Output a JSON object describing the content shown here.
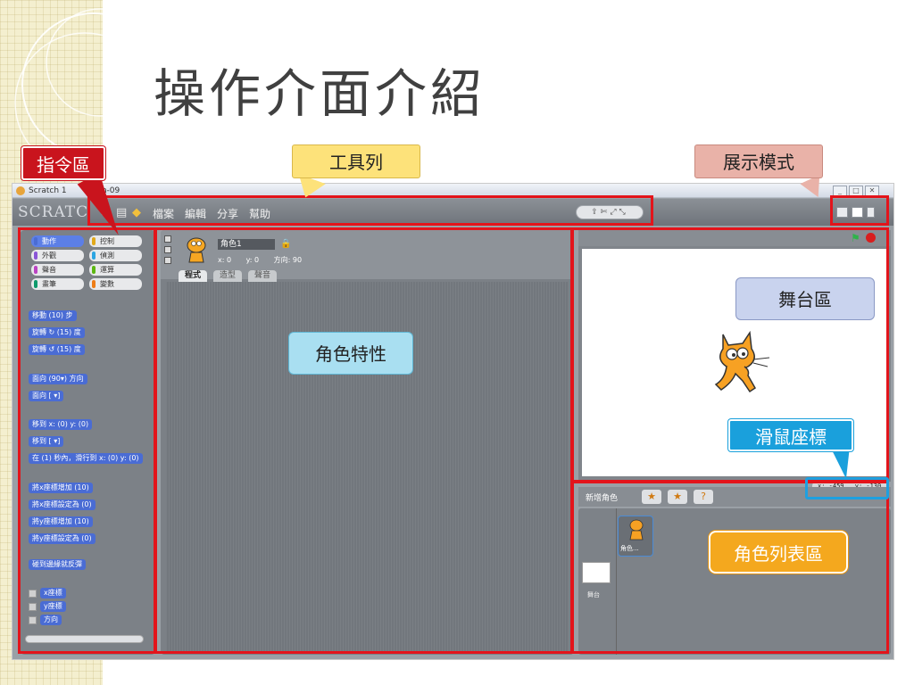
{
  "slide": {
    "title": "操作介面介紹"
  },
  "callouts": {
    "command_area": "指令區",
    "toolbar": "工具列",
    "display_mode": "展示模式",
    "stage_area": "舞台區",
    "sprite_props": "角色特性",
    "mouse_coords": "滑鼠座標",
    "sprite_list": "角色列表區"
  },
  "window": {
    "title": "Scratch 1",
    "title_suffix": "0-Jun-09"
  },
  "app": {
    "logo": "SCRATC",
    "menu": [
      "檔案",
      "編輯",
      "分享",
      "幫助"
    ]
  },
  "palette": {
    "categories": [
      "動作",
      "控制",
      "外觀",
      "偵測",
      "聲音",
      "運算",
      "畫筆",
      "變數"
    ],
    "category_colors": [
      "#4a6cd4",
      "#e1a91a",
      "#8a55d7",
      "#2ca5e2",
      "#bb42c3",
      "#5cb712",
      "#0e9a6c",
      "#ee7d16"
    ],
    "blocks": [
      "移動 (10) 步",
      "旋轉 ↻ (15) 度",
      "旋轉 ↺ (15) 度",
      "面向 (90▾) 方向",
      "面向 [ ▾]",
      "移到 x: (0) y: (0)",
      "移到 [ ▾]",
      "在 (1) 秒內，滑行到 x: (0) y: (0)",
      "將x座標增加 (10)",
      "將x座標設定為 (0)",
      "將y座標增加 (10)",
      "將y座標設定為 (0)",
      "碰到邊緣就反彈"
    ],
    "reporters": [
      "x座標",
      "y座標",
      "方向"
    ]
  },
  "sprite": {
    "name": "角色1",
    "x_label": "x: 0",
    "y_label": "y: 0",
    "direction_label": "方向: 90",
    "tabs": [
      "程式",
      "造型",
      "聲音"
    ]
  },
  "stage": {
    "mouse_x": "x: -459",
    "mouse_y": "y: -130"
  },
  "sprite_list": {
    "header": "新增角色",
    "sprite_label": "角色...",
    "stage_label": "舞台"
  }
}
